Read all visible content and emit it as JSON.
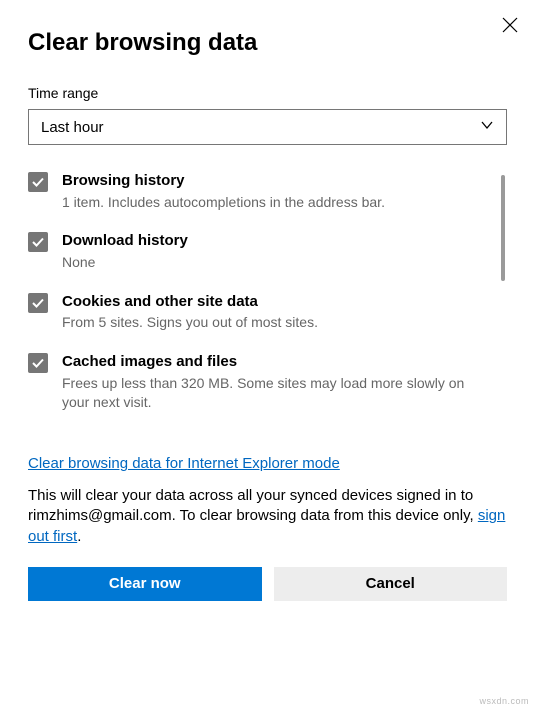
{
  "title": "Clear browsing data",
  "time_range_label": "Time range",
  "time_range_value": "Last hour",
  "options": [
    {
      "title": "Browsing history",
      "desc": "1 item. Includes autocompletions in the address bar.",
      "checked": true
    },
    {
      "title": "Download history",
      "desc": "None",
      "checked": true
    },
    {
      "title": "Cookies and other site data",
      "desc": "From 5 sites. Signs you out of most sites.",
      "checked": true
    },
    {
      "title": "Cached images and files",
      "desc": "Frees up less than 320 MB. Some sites may load more slowly on your next visit.",
      "checked": true
    }
  ],
  "ie_link": "Clear browsing data for Internet Explorer mode",
  "disclaimer_before": "This will clear your data across all your synced devices signed in to rimzhims@gmail.com. To clear browsing data from this device only, ",
  "sign_out_link": "sign out first",
  "disclaimer_after": ".",
  "btn_primary": "Clear now",
  "btn_secondary": "Cancel",
  "watermark": "wsxdn.com"
}
